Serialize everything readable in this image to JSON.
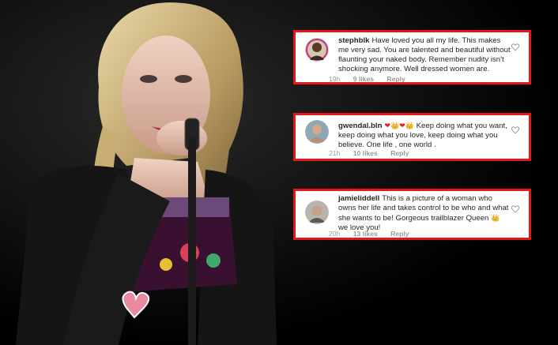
{
  "comments": [
    {
      "username": "stephblk",
      "text": "Have loved you all my life. This makes me very sad. You are talented and beautiful without flaunting your naked body. Remember nudity isn't shocking anymore. Well dressed women are.",
      "time": "19h",
      "likes": "9 likes",
      "reply": "Reply"
    },
    {
      "username": "gwendal.bln",
      "emoji_1": "❤",
      "emoji_2": "👑",
      "emoji_3": "❤",
      "emoji_4": "👑",
      "text": "Keep doing what you want, keep doing what you love, keep doing what you believe. One life , one world .",
      "time": "21h",
      "likes": "10 likes",
      "reply": "Reply"
    },
    {
      "username": "jamieliddell",
      "text_before": "This is a picture of a woman who owns her life and takes control to be who and what she wants to be!  Gorgeous trailblazer Queen ",
      "emoji": "👑",
      "text_after": " we love you!",
      "time": "20h",
      "likes": "13 likes",
      "reply": "Reply"
    }
  ],
  "colors": {
    "border": "#e8151b",
    "background": "#000000",
    "meta": "#999999"
  },
  "icons": [
    "heart-outline-icon",
    "avatar"
  ]
}
